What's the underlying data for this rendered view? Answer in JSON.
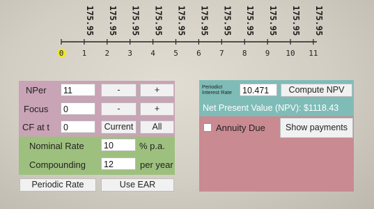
{
  "timeline": {
    "periods": [
      "0",
      "1",
      "2",
      "3",
      "4",
      "5",
      "6",
      "7",
      "8",
      "9",
      "10",
      "11"
    ],
    "cashflow_label": "175.95",
    "cashflow_count": 11,
    "highlight_period": "0",
    "highlight_color": "#f2e81a"
  },
  "left": {
    "nper_label": "NPer",
    "nper_value": "11",
    "focus_label": "Focus",
    "focus_value": "0",
    "cf_label": "CF at t",
    "cf_value": "0",
    "minus_label": "-",
    "plus_label": "+",
    "current_label": "Current",
    "all_label": "All"
  },
  "rates": {
    "nominal_label": "Nominal Rate",
    "nominal_value": "10",
    "nominal_unit": "% p.a.",
    "compounding_label": "Compounding",
    "compounding_value": "12",
    "compounding_unit": "per year",
    "periodic_rate_button": "Periodic Rate",
    "use_ear_button": "Use EAR"
  },
  "result": {
    "periodic_rate_label_1": "Periodict",
    "periodic_rate_label_2": "Interest Rate",
    "periodic_rate_value": "10.471",
    "compute_button": "Compute NPV",
    "npv_text": "Net Present Value (NPV): $1118.43",
    "annuity_due_label": "Annuity Due",
    "annuity_due_checked": false,
    "show_payments_button": "Show payments"
  },
  "colors": {
    "npv_panel": "#c9a3b6",
    "rate_panel": "#9ec07e",
    "result_top": "#7fbcb7",
    "result_body": "#c98a92"
  }
}
